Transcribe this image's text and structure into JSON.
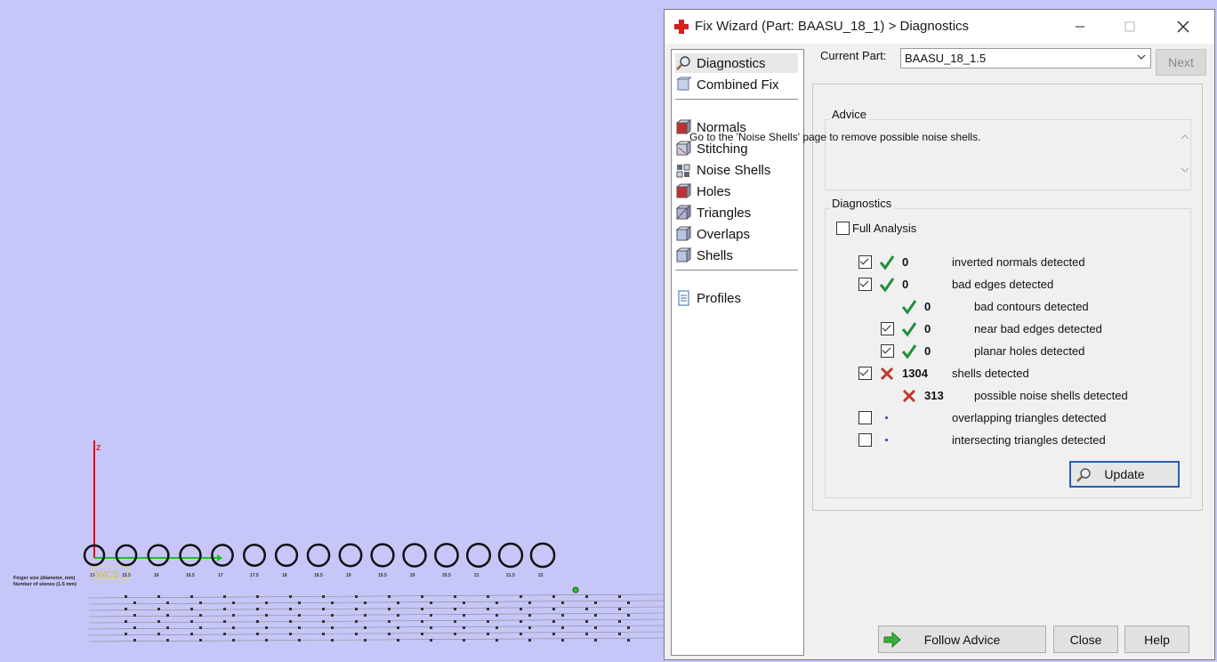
{
  "viewport": {
    "axis_label_z": "z",
    "wcs_label": "WCS",
    "legend_rows": [
      "Finger size (diameter, mm)",
      "Number of stones (1.5 mm)"
    ],
    "ring_sizes": [
      "15",
      "15.5",
      "16",
      "16.5",
      "17",
      "17.5",
      "18",
      "18.5",
      "19",
      "19.5",
      "20",
      "20.5",
      "21",
      "21.5",
      "22"
    ]
  },
  "dialog": {
    "title": "Fix Wizard (Part: BAASU_18_1) > Diagnostics",
    "nav_groups": [
      [
        {
          "label": "Diagnostics",
          "icon": "magnifier-icon",
          "selected": true
        },
        {
          "label": "Combined Fix",
          "icon": "combined-fix-icon"
        }
      ],
      [
        {
          "label": "Normals",
          "icon": "normals-icon"
        },
        {
          "label": "Stitching",
          "icon": "stitching-icon"
        },
        {
          "label": "Noise Shells",
          "icon": "noise-shells-icon"
        },
        {
          "label": "Holes",
          "icon": "holes-icon"
        },
        {
          "label": "Triangles",
          "icon": "triangles-icon"
        },
        {
          "label": "Overlaps",
          "icon": "overlaps-icon"
        },
        {
          "label": "Shells",
          "icon": "shells-icon"
        }
      ],
      [
        {
          "label": "Profiles",
          "icon": "profiles-icon"
        }
      ]
    ],
    "current_part_label": "Current Part:",
    "current_part_value": "BAASU_18_1.5",
    "next_label": "Next",
    "advice_title": "Advice",
    "advice_text": "Go to the 'Noise Shells' page to remove possible noise shells.",
    "diagnostics_title": "Diagnostics",
    "full_analysis_label": "Full Analysis",
    "full_analysis_checked": false,
    "rows": [
      {
        "checkbox": true,
        "checked": true,
        "status": "ok",
        "count": "0",
        "label": "inverted normals detected",
        "indent": 0
      },
      {
        "checkbox": true,
        "checked": true,
        "status": "ok",
        "count": "0",
        "label": "bad edges detected",
        "indent": 0
      },
      {
        "checkbox": false,
        "checked": false,
        "status": "ok",
        "count": "0",
        "label": "bad contours detected",
        "indent": 1
      },
      {
        "checkbox": true,
        "checked": true,
        "status": "ok",
        "count": "0",
        "label": "near bad edges detected",
        "indent": 1
      },
      {
        "checkbox": true,
        "checked": true,
        "status": "ok",
        "count": "0",
        "label": "planar holes detected",
        "indent": 1
      },
      {
        "checkbox": true,
        "checked": true,
        "status": "error",
        "count": "1304",
        "label": "shells detected",
        "indent": 0
      },
      {
        "checkbox": false,
        "checked": false,
        "status": "error",
        "count": "313",
        "label": "possible noise shells detected",
        "indent": 1
      },
      {
        "checkbox": true,
        "checked": false,
        "status": "none",
        "count": "",
        "label": "overlapping triangles detected",
        "indent": 0
      },
      {
        "checkbox": true,
        "checked": false,
        "status": "none",
        "count": "",
        "label": "intersecting triangles detected",
        "indent": 0
      }
    ],
    "update_label": "Update",
    "follow_advice_label": "Follow Advice",
    "close_label": "Close",
    "help_label": "Help",
    "colors": {
      "ok": "#1f8f3a",
      "error": "#c0392b",
      "accent": "#2a5db0",
      "app_icon": "#d42020"
    }
  }
}
